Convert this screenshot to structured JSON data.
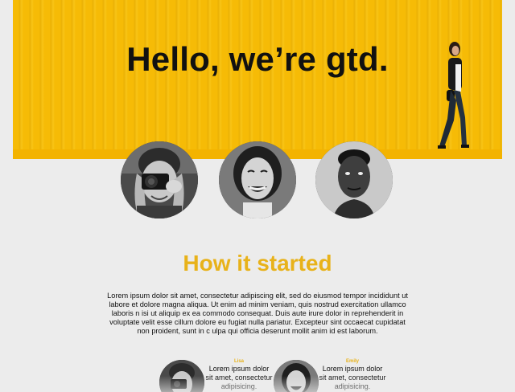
{
  "hero": {
    "title": "Hello, we’re gtd.",
    "background_color": "#f6bb06"
  },
  "team": [
    {
      "name": "photographer-avatar",
      "icon": "person-with-camera"
    },
    {
      "name": "smiling-woman-avatar",
      "icon": "smiling-woman"
    },
    {
      "name": "man-avatar",
      "icon": "man-portrait"
    }
  ],
  "about": {
    "title": "How it started",
    "title_color": "#e8b21a",
    "body": "Lorem ipsum dolor sit amet, consectetur adipiscing elit, sed do eiusmod tempor incididunt ut labore et dolore magna aliqua. Ut enim ad minim veniam, quis nostrud exercitation ullamco laboris n isi ut aliquip ex ea commodo consequat. Duis aute irure dolor in reprehenderit in voluptate velit esse cillum dolore eu fugiat nulla pariatur. Excepteur sint occaecat cupidatat non proident, sunt in c ulpa qui officia deserunt mollit anim id est laborum."
  },
  "testimonials": [
    {
      "name": "Lisa",
      "quote": "Lorem ipsum dolor sit amet, consectetur adipisicing."
    },
    {
      "name": "Emily",
      "quote": "Lorem ipsum dolor sit amet, consectetur adipisicing."
    }
  ]
}
